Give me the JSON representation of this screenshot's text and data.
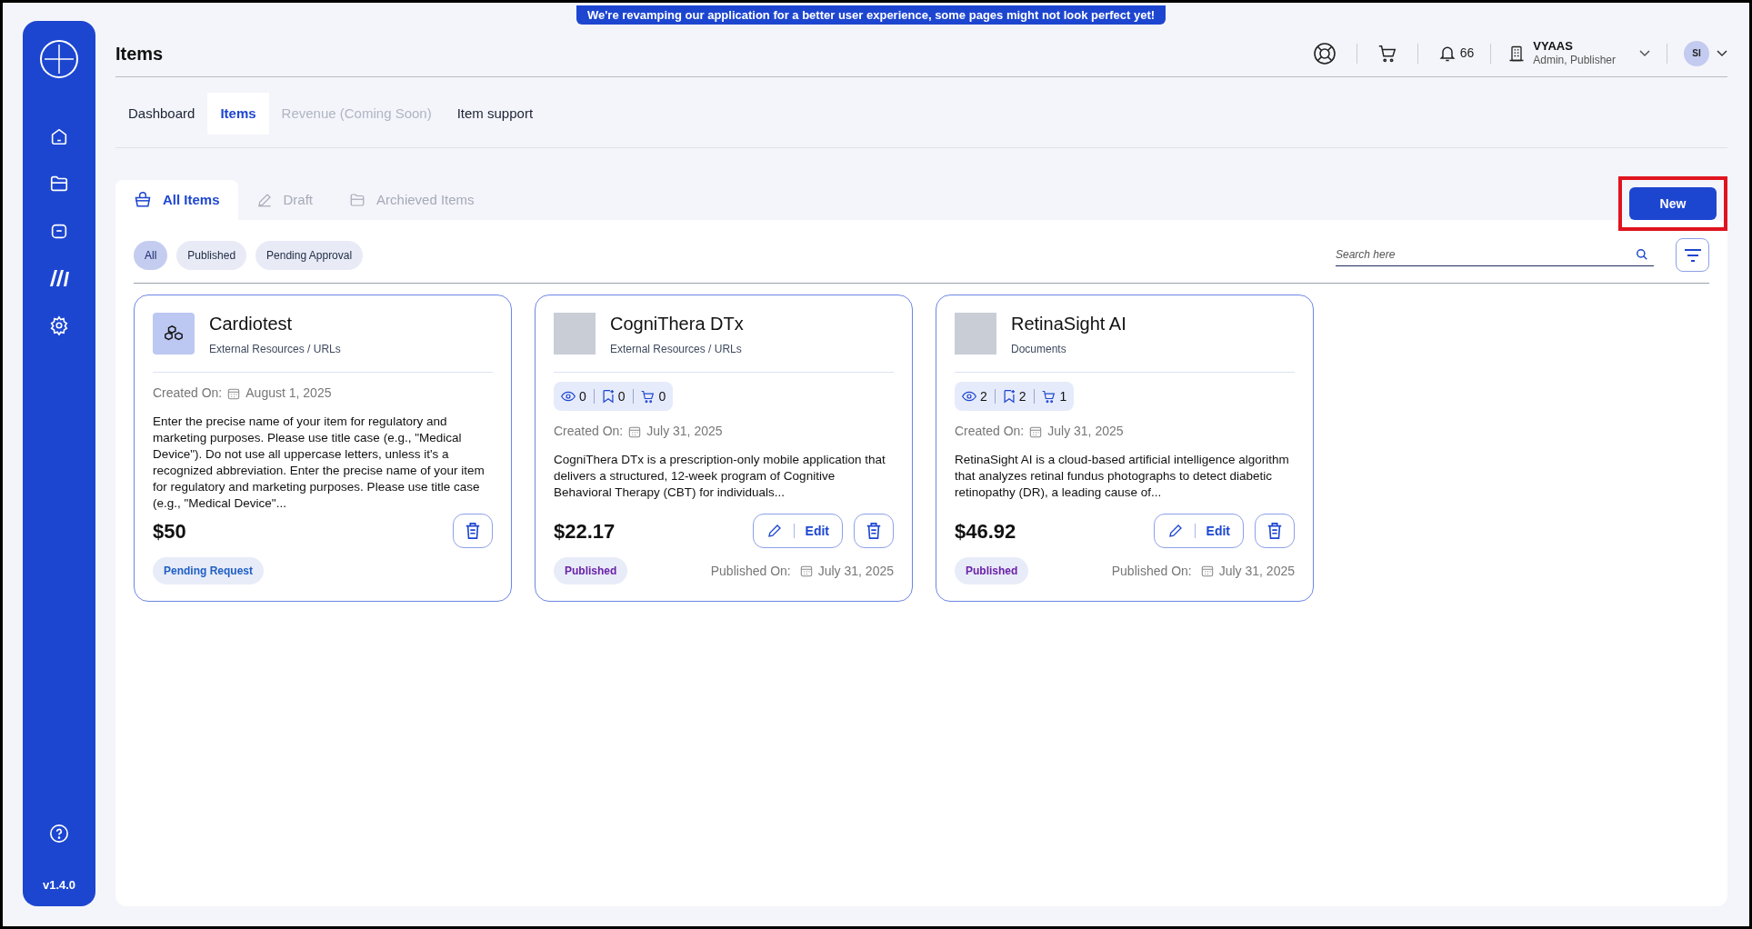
{
  "banner": "We're revamping our application for a better user experience, some pages might not look perfect yet!",
  "sidebar": {
    "version": "v1.4.0"
  },
  "header": {
    "title": "Items",
    "notification_count": "66",
    "user": {
      "name": "VYAAS",
      "role": "Admin, Publisher",
      "initials": "SI"
    }
  },
  "nav_tabs": [
    {
      "label": "Dashboard",
      "selected": false,
      "disabled": false
    },
    {
      "label": "Items",
      "selected": true,
      "disabled": false
    },
    {
      "label": "Revenue (Coming Soon)",
      "selected": false,
      "disabled": true
    },
    {
      "label": "Item support",
      "selected": false,
      "disabled": false
    }
  ],
  "sub_tabs": [
    {
      "label": "All Items",
      "kind": "basket",
      "selected": true
    },
    {
      "label": "Draft",
      "kind": "pencil",
      "selected": false
    },
    {
      "label": "Archieved Items",
      "kind": "folder",
      "selected": false
    }
  ],
  "new_button": "New",
  "filters": [
    {
      "label": "All",
      "selected": true
    },
    {
      "label": "Published",
      "selected": false
    },
    {
      "label": "Pending Approval",
      "selected": false
    }
  ],
  "search": {
    "placeholder": "Search here"
  },
  "cards": [
    {
      "title": "Cardiotest",
      "category": "External Resources / URLs",
      "photo": false,
      "created_label": "Created On:",
      "created_date": "August 1, 2025",
      "description": "Enter the precise name of your item for regulatory and marketing purposes. Please use title case (e.g., \"Medical Device\"). Do not use all uppercase letters, unless it's a recognized abbreviation. Enter the precise name of your item for regulatory and marketing purposes. Please use title case (e.g., \"Medical Device\"...",
      "price": "$50",
      "status": {
        "label": "Pending Request",
        "color": "#1f5fc4"
      }
    },
    {
      "title": "CogniThera DTx",
      "category": "External Resources / URLs",
      "photo": true,
      "stats": [
        {
          "kind": "views",
          "count": "0"
        },
        {
          "kind": "saves",
          "count": "0"
        },
        {
          "kind": "cart",
          "count": "0"
        }
      ],
      "created_label": "Created On:",
      "created_date": "July 31, 2025",
      "description": "CogniThera DTx is a prescription-only mobile application that delivers a structured, 12-week program of Cognitive Behavioral Therapy (CBT) for individuals...",
      "price": "$22.17",
      "edit_label": "Edit",
      "status": {
        "label": "Published",
        "color": "#6b21a8"
      },
      "published_label": "Published On:",
      "published_date": "July 31, 2025"
    },
    {
      "title": "RetinaSight AI",
      "category": "Documents",
      "photo": true,
      "stats": [
        {
          "kind": "views",
          "count": "2"
        },
        {
          "kind": "saves",
          "count": "2"
        },
        {
          "kind": "cart",
          "count": "1"
        }
      ],
      "created_label": "Created On:",
      "created_date": "July 31, 2025",
      "description": "RetinaSight AI is a cloud-based artificial intelligence algorithm that analyzes retinal fundus photographs to detect diabetic retinopathy (DR), a leading cause of...",
      "price": "$46.92",
      "edit_label": "Edit",
      "status": {
        "label": "Published",
        "color": "#6b21a8"
      },
      "published_label": "Published On:",
      "published_date": "July 31, 2025"
    }
  ]
}
